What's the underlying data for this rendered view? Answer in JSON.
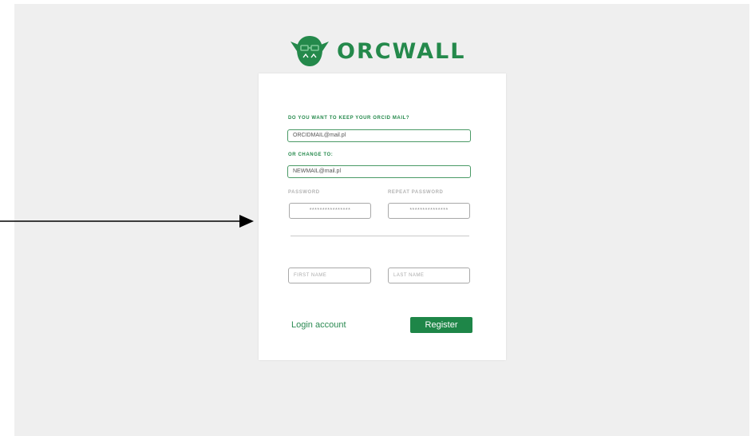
{
  "brand": {
    "name": "ORCWALL",
    "logo": "orc-head-logo",
    "accent": "#24894b"
  },
  "form": {
    "keep_label": "DO YOU WANT TO KEEP YOUR ORCID MAIL?",
    "orcid_mail_value": "ORCIDMAIL@mail.pl",
    "change_label": "OR CHANGE TO:",
    "new_mail_value": "NEWMAIL@mail.pl",
    "password_label": "PASSWORD",
    "repeat_password_label": "REPEAT PASSWORD",
    "password_value": "****************",
    "repeat_password_value": "***************",
    "first_name_placeholder": "FIRST NAME",
    "last_name_placeholder": "LAST NAME",
    "login_link": "Login account",
    "register_button": "Register"
  },
  "annotation": {
    "arrow": "right-arrow"
  }
}
